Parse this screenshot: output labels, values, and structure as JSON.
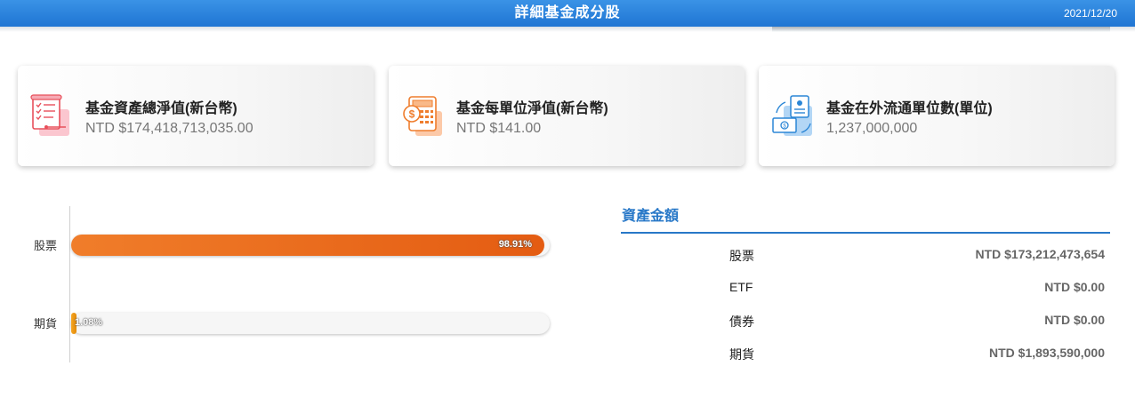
{
  "header": {
    "title": "詳細基金成分股",
    "date": "2021/12/20",
    "accent": "#1f75d3"
  },
  "cards": [
    {
      "icon": "document-checklist-icon",
      "label": "基金資產總淨值(新台幣)",
      "value": "NTD $174,418,713,035.00"
    },
    {
      "icon": "calculator-dollar-icon",
      "label": "基金每單位淨值(新台幣)",
      "value": "NTD $141.00"
    },
    {
      "icon": "money-id-card-icon",
      "label": "基金在外流通單位數(單位)",
      "value": "1,237,000,000"
    }
  ],
  "chart_data": {
    "type": "bar",
    "orientation": "horizontal",
    "categories": [
      "股票",
      "期貨"
    ],
    "values": [
      98.91,
      1.08
    ],
    "value_labels": [
      "98.91%",
      "1.08%"
    ],
    "unit": "%",
    "xlim": [
      0,
      100
    ],
    "colors": [
      "#e9691b",
      "#f0a020"
    ]
  },
  "assets": {
    "title": "資產金額",
    "rows": [
      {
        "name": "股票",
        "value": "NTD $173,212,473,654"
      },
      {
        "name": "ETF",
        "value": "NTD $0.00"
      },
      {
        "name": "債券",
        "value": "NTD $0.00"
      },
      {
        "name": "期貨",
        "value": "NTD $1,893,590,000"
      }
    ]
  }
}
